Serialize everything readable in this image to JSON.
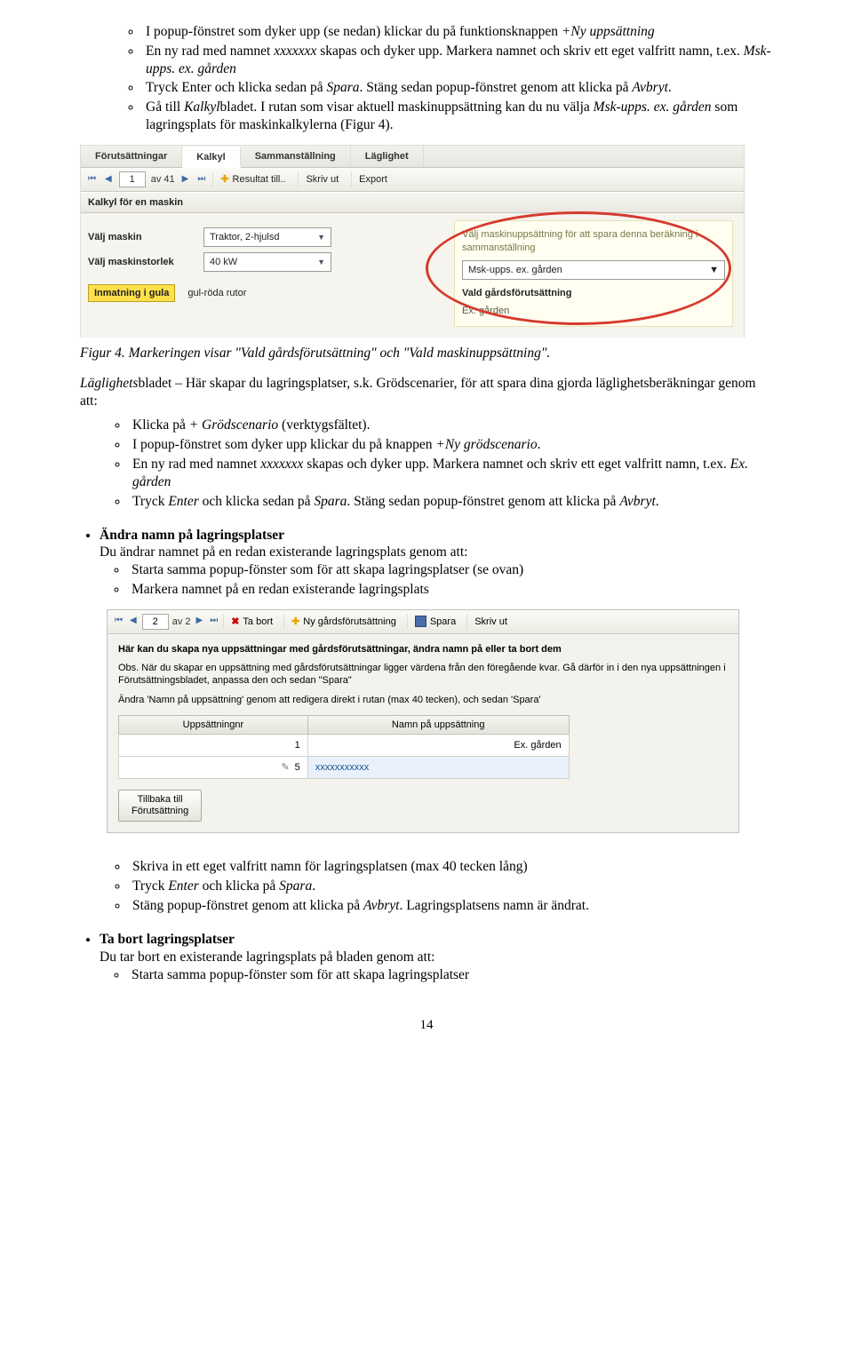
{
  "intro_list": [
    {
      "segments": [
        {
          "t": "I popup-fönstret som dyker upp (se nedan) klickar du på funktionsknappen "
        },
        {
          "t": "+Ny uppsättning",
          "i": true
        }
      ]
    },
    {
      "segments": [
        {
          "t": "En ny rad med namnet "
        },
        {
          "t": "xxxxxxx",
          "i": true
        },
        {
          "t": " skapas och dyker upp. Markera namnet och skriv ett eget valfritt namn, t.ex. "
        },
        {
          "t": "Msk-upps. ex. gården",
          "i": true
        }
      ]
    },
    {
      "segments": [
        {
          "t": "Tryck Enter och klicka sedan på "
        },
        {
          "t": "Spara",
          "i": true
        },
        {
          "t": ". Stäng sedan popup-fönstret genom att klicka på "
        },
        {
          "t": "Avbryt",
          "i": true
        },
        {
          "t": "."
        }
      ]
    },
    {
      "segments": [
        {
          "t": "Gå till "
        },
        {
          "t": "Kalkyl",
          "i": true
        },
        {
          "t": "bladet. I rutan som visar aktuell maskinuppsättning kan du nu välja "
        },
        {
          "t": "Msk-upps. ex. gården",
          "i": true
        },
        {
          "t": " som lagringsplats för maskinkalkylerna (Figur 4)."
        }
      ]
    }
  ],
  "fig4": {
    "tabs": [
      "Förutsättningar",
      "Kalkyl",
      "Sammanställning",
      "Läglighet"
    ],
    "active_tab_index": 1,
    "pager_value": "1",
    "pager_total": "av 41",
    "btn_result": "Resultat till..",
    "btn_print": "Skriv ut",
    "btn_export": "Export",
    "section_title": "Kalkyl för en maskin",
    "row1_label": "Välj maskin",
    "row1_value": "Traktor, 2-hjulsd",
    "row2_label": "Välj maskinstorlek",
    "row2_value": "40 kW",
    "badge_label": "Inmatning i gula",
    "badge_text": "gul-röda rutor",
    "hint": "Välj maskinuppsättning för att spara denna beräkning i sammanställning",
    "sel_value": "Msk-upps. ex. gården",
    "group_title": "Vald gårdsförutsättning",
    "group_value": "Ex. gården"
  },
  "fig4_caption_prefix": "Figur 4. Markeringen visar \"Vald gårdsförutsättning\" och \"Vald maskinuppsättning\".",
  "laglighet_para": {
    "segments": [
      {
        "t": "Läglighets",
        "i": true
      },
      {
        "t": "bladet – Här skapar du lagringsplatser, s.k. Grödscenarier, för att spara dina gjorda läglighetsberäkningar genom att:"
      }
    ]
  },
  "laglighet_list": [
    {
      "segments": [
        {
          "t": "Klicka på "
        },
        {
          "t": "+ Grödscenario",
          "i": true
        },
        {
          "t": " (verktygsfältet)."
        }
      ]
    },
    {
      "segments": [
        {
          "t": "I popup-fönstret som dyker upp klickar du på knappen "
        },
        {
          "t": "+Ny grödscenario",
          "i": true
        },
        {
          "t": "."
        }
      ]
    },
    {
      "segments": [
        {
          "t": "En ny rad med namnet "
        },
        {
          "t": "xxxxxxx",
          "i": true
        },
        {
          "t": " skapas och dyker upp. Markera namnet och skriv ett eget valfritt namn, t.ex. "
        },
        {
          "t": "Ex. gården",
          "i": true
        }
      ]
    },
    {
      "segments": [
        {
          "t": "Tryck "
        },
        {
          "t": "Enter",
          "i": true
        },
        {
          "t": " och klicka sedan på "
        },
        {
          "t": "Spara",
          "i": true
        },
        {
          "t": ". Stäng sedan popup-fönstret genom att klicka på "
        },
        {
          "t": "Avbryt",
          "i": true
        },
        {
          "t": "."
        }
      ]
    }
  ],
  "andra_heading": "Ändra namn på lagringsplatser",
  "andra_intro": "Du ändrar namnet på en redan existerande lagringsplats genom att:",
  "andra_list": [
    "Starta samma popup-fönster som för att skapa lagringsplatser (se ovan)",
    "Markera namnet på en redan existerande lagringsplats"
  ],
  "shot2": {
    "pager_value": "2",
    "pager_total": "av 2",
    "btn_delete": "Ta bort",
    "btn_new": "Ny gårdsförutsättning",
    "btn_save": "Spara",
    "btn_print": "Skriv ut",
    "bold1": "Här kan du skapa nya uppsättningar med gårdsförutsättningar, ändra namn på eller ta bort dem",
    "obs": "Obs. När du skapar en uppsättning med gårdsförutsättningar ligger värdena från den föregående kvar. Gå därför in i den nya uppsättningen i Förutsättningsbladet, anpassa den och sedan \"Spara\"",
    "andra_line": "Ändra 'Namn på uppsättning' genom att redigera direkt i rutan (max 40 tecken), och sedan 'Spara'",
    "th1": "Uppsättningnr",
    "th2": "Namn på uppsättning",
    "r1c1": "1",
    "r1c2": "Ex. gården",
    "r2c1": "5",
    "r2c2": "xxxxxxxxxxx",
    "back_btn": "Tillbaka till\nFörutsättning"
  },
  "efter_shot2_list": [
    {
      "segments": [
        {
          "t": "Skriva in ett eget valfritt namn för lagringsplatsen (max 40 tecken lång)"
        }
      ]
    },
    {
      "segments": [
        {
          "t": "Tryck "
        },
        {
          "t": "Enter",
          "i": true
        },
        {
          "t": " och klicka på "
        },
        {
          "t": "Spara",
          "i": true
        },
        {
          "t": "."
        }
      ]
    },
    {
      "segments": [
        {
          "t": "Stäng popup-fönstret genom att klicka på "
        },
        {
          "t": "Avbryt",
          "i": true
        },
        {
          "t": ". Lagringsplatsens namn är ändrat."
        }
      ]
    }
  ],
  "ta_bort_heading": "Ta bort lagringsplatser",
  "ta_bort_intro": "Du tar bort en existerande lagringsplats på bladen genom att:",
  "ta_bort_list": [
    "Starta samma popup-fönster som för att skapa lagringsplatser"
  ],
  "page_number": "14"
}
